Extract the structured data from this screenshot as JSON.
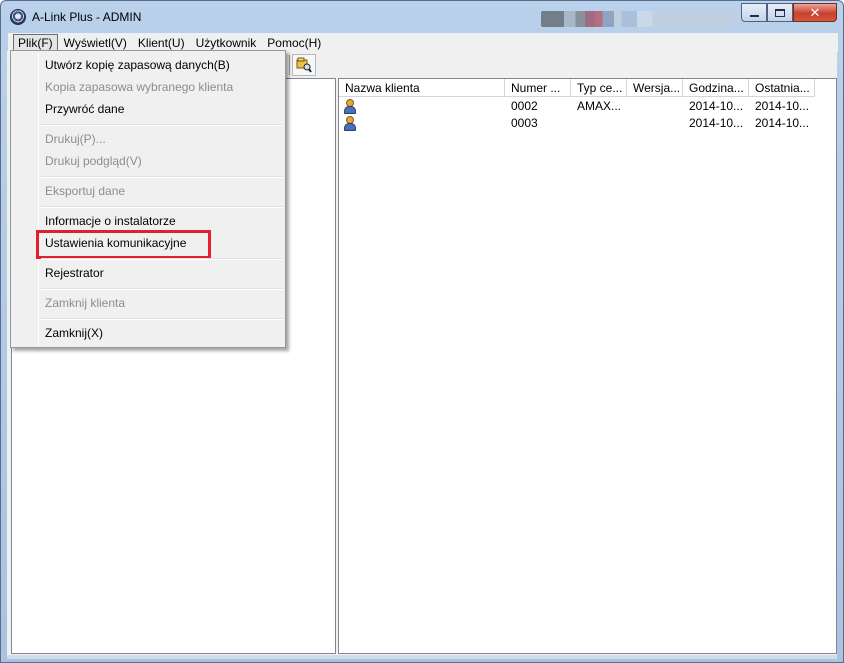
{
  "window": {
    "title": "A-Link Plus - ADMIN"
  },
  "menubar": {
    "items": [
      "Plik(F)",
      "Wyświetl(V)",
      "Klient(U)",
      "Użytkownik",
      "Pomoc(H)"
    ]
  },
  "file_menu": {
    "items": [
      {
        "label": "Utwórz kopię zapasową danych(B)",
        "enabled": true
      },
      {
        "label": "Kopia zapasowa wybranego klienta",
        "enabled": false
      },
      {
        "label": "Przywróć dane",
        "enabled": true
      },
      {
        "label": "Drukuj(P)...",
        "enabled": false
      },
      {
        "label": "Drukuj podgląd(V)",
        "enabled": false
      },
      {
        "label": "Eksportuj dane",
        "enabled": false
      },
      {
        "label": "Informacje o instalatorze",
        "enabled": true
      },
      {
        "label": "Ustawienia komunikacyjne",
        "enabled": true,
        "highlighted": true
      },
      {
        "label": "Rejestrator",
        "enabled": true
      },
      {
        "label": "Zamknij klienta",
        "enabled": false
      },
      {
        "label": "Zamknij(X)",
        "enabled": true
      }
    ]
  },
  "client_list": {
    "columns": [
      "Nazwa klienta",
      "Numer ...",
      "Typ ce...",
      "Wersja...",
      "Godzina...",
      "Ostatnia..."
    ],
    "rows": [
      {
        "name": "",
        "number": "0002",
        "type": "AMAX...",
        "version": "",
        "time": "2014-10...",
        "last": "2014-10..."
      },
      {
        "name": "",
        "number": "0003",
        "type": "",
        "version": "",
        "time": "2014-10...",
        "last": "2014-10..."
      }
    ]
  },
  "colors": {
    "highlight_box": "#e0202f",
    "disabled_text": "#8d8d8d",
    "title_bar": "#b9d1ea"
  },
  "icons": {
    "app": "app-logo-icon",
    "toolbar": "find-client-icon",
    "row": "user-icon"
  }
}
